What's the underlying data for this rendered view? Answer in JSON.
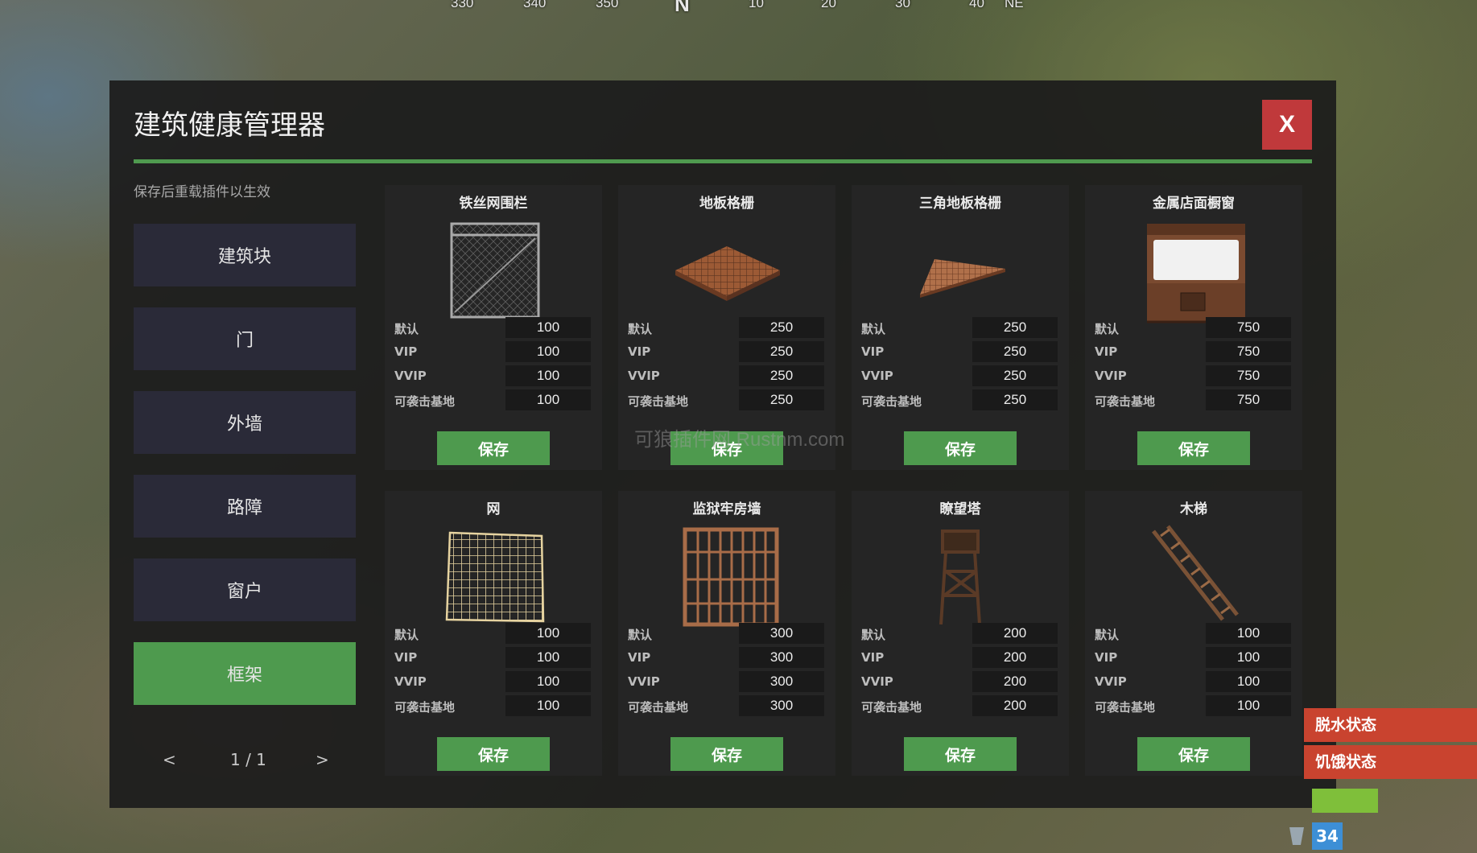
{
  "compass": {
    "ticks": [
      "330",
      "340",
      "350",
      "N",
      "10",
      "20",
      "30",
      "40",
      "NE"
    ]
  },
  "window": {
    "title": "建筑健康管理器",
    "close_label": "X",
    "subtitle": "保存后重载插件以生效"
  },
  "sidebar": {
    "items": [
      {
        "label": "建筑块",
        "active": false
      },
      {
        "label": "门",
        "active": false
      },
      {
        "label": "外墙",
        "active": false
      },
      {
        "label": "路障",
        "active": false
      },
      {
        "label": "窗户",
        "active": false
      },
      {
        "label": "框架",
        "active": true
      }
    ],
    "pager": {
      "prev": "<",
      "page": "1 / 1",
      "next": ">"
    }
  },
  "stat_labels": {
    "default": "默认",
    "vip": "VIP",
    "vvip": "VVIP",
    "raidable": "可袭击基地"
  },
  "save_label": "保存",
  "cards": [
    {
      "title": "铁丝网围栏",
      "icon": "chainlink-fence-icon",
      "default": "100",
      "vip": "100",
      "vvip": "100",
      "raidable": "100"
    },
    {
      "title": "地板格栅",
      "icon": "floor-grill-icon",
      "default": "250",
      "vip": "250",
      "vvip": "250",
      "raidable": "250"
    },
    {
      "title": "三角地板格栅",
      "icon": "triangle-floor-grill-icon",
      "default": "250",
      "vip": "250",
      "vvip": "250",
      "raidable": "250"
    },
    {
      "title": "金属店面橱窗",
      "icon": "metal-shop-front-icon",
      "default": "750",
      "vip": "750",
      "vvip": "750",
      "raidable": "750"
    },
    {
      "title": "网",
      "icon": "netting-icon",
      "default": "100",
      "vip": "100",
      "vvip": "100",
      "raidable": "100"
    },
    {
      "title": "监狱牢房墙",
      "icon": "prison-cell-wall-icon",
      "default": "300",
      "vip": "300",
      "vvip": "300",
      "raidable": "300"
    },
    {
      "title": "瞭望塔",
      "icon": "watchtower-icon",
      "default": "200",
      "vip": "200",
      "vvip": "200",
      "raidable": "200"
    },
    {
      "title": "木梯",
      "icon": "wooden-ladder-icon",
      "default": "100",
      "vip": "100",
      "vvip": "100",
      "raidable": "100"
    }
  ],
  "watermark": "可狼插件网 Rustnm.com",
  "hud": {
    "status_thirst": "脱水状态",
    "status_hunger": "饥饿状态",
    "counter": "34"
  },
  "colors": {
    "accent_green": "#4e9a4e",
    "close_red": "#c0393b",
    "status_red": "#c9432f",
    "hud_blue": "#3d8fd6"
  }
}
